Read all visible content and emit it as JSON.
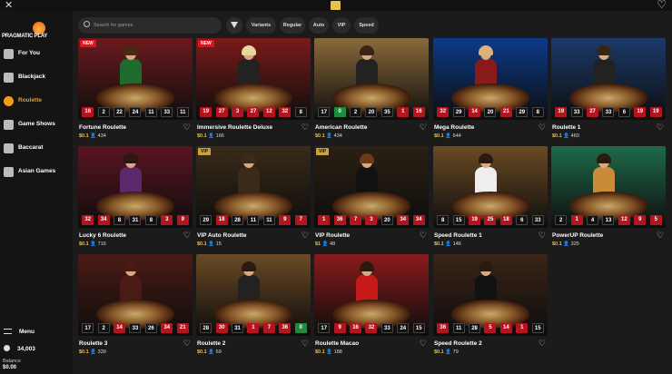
{
  "topbar": {
    "close_glyph": "✕",
    "heart_glyph": "♡"
  },
  "brand": {
    "name": "PRAGMATIC PLAY"
  },
  "sidebar": {
    "items": [
      {
        "label": "For You",
        "icon": "sparkle-icon",
        "active": false
      },
      {
        "label": "Blackjack",
        "icon": "cards-icon",
        "active": false
      },
      {
        "label": "Roulette",
        "icon": "roulette-icon",
        "active": true
      },
      {
        "label": "Game Shows",
        "icon": "gameshow-icon",
        "active": false
      },
      {
        "label": "Baccarat",
        "icon": "baccarat-icon",
        "active": false
      },
      {
        "label": "Asian Games",
        "icon": "asian-games-icon",
        "active": false
      }
    ],
    "menu_label": "Menu",
    "player_count": "34,003",
    "balance_label": "Balance",
    "balance_value": "$0.00"
  },
  "filters": {
    "search_placeholder": "Search for games",
    "chips": [
      "Variants",
      "Regular",
      "Auto",
      "VIP",
      "Speed"
    ]
  },
  "games": [
    {
      "title": "Fortune Roulette",
      "stake": "$0.1",
      "players": "434",
      "badge": "NEW",
      "numbers": [
        [
          "16",
          "r"
        ],
        [
          "2",
          "b"
        ],
        [
          "22",
          "b"
        ],
        [
          "24",
          "b"
        ],
        [
          "11",
          "b"
        ],
        [
          "33",
          "b"
        ],
        [
          "11",
          "b"
        ]
      ],
      "bg": "#6b1a1e",
      "hair": "#4a2a14",
      "body": "#1f6b2e"
    },
    {
      "title": "Immersive Roulette Deluxe",
      "stake": "$0.1",
      "players": "166",
      "badge": "NEW",
      "numbers": [
        [
          "19",
          "r"
        ],
        [
          "27",
          "r"
        ],
        [
          "3",
          "r"
        ],
        [
          "27",
          "r"
        ],
        [
          "12",
          "r"
        ],
        [
          "32",
          "r"
        ],
        [
          "8",
          "b"
        ]
      ],
      "bg": "#7a1a1a",
      "hair": "#e8d6a0",
      "body": "#222"
    },
    {
      "title": "American Roulette",
      "stake": "$0.1",
      "players": "434",
      "badge": "",
      "numbers": [
        [
          "17",
          "b"
        ],
        [
          "0",
          "g"
        ],
        [
          "2",
          "b"
        ],
        [
          "20",
          "b"
        ],
        [
          "35",
          "b"
        ],
        [
          "1",
          "r"
        ],
        [
          "16",
          "r"
        ]
      ],
      "bg": "#8a6a3a",
      "hair": "#3a2414",
      "body": "#222"
    },
    {
      "title": "Mega Roulette",
      "stake": "$0.1",
      "players": "644",
      "badge": "",
      "numbers": [
        [
          "32",
          "r"
        ],
        [
          "29",
          "b"
        ],
        [
          "14",
          "r"
        ],
        [
          "20",
          "b"
        ],
        [
          "21",
          "r"
        ],
        [
          "29",
          "b"
        ],
        [
          "8",
          "b"
        ]
      ],
      "bg": "#0c3a8a",
      "hair": "#d9b37a",
      "body": "#8a1a1a"
    },
    {
      "title": "Roulette 1",
      "stake": "$0.1",
      "players": "460",
      "badge": "",
      "numbers": [
        [
          "19",
          "r"
        ],
        [
          "33",
          "b"
        ],
        [
          "27",
          "r"
        ],
        [
          "33",
          "b"
        ],
        [
          "6",
          "b"
        ],
        [
          "19",
          "r"
        ],
        [
          "19",
          "r"
        ]
      ],
      "bg": "#1c3a6a",
      "hair": "#3a2414",
      "body": "#222"
    },
    {
      "title": "Lucky 6 Roulette",
      "stake": "$0.1",
      "players": "716",
      "badge": "",
      "numbers": [
        [
          "32",
          "r"
        ],
        [
          "34",
          "r"
        ],
        [
          "8",
          "b"
        ],
        [
          "31",
          "b"
        ],
        [
          "8",
          "b"
        ],
        [
          "3",
          "r"
        ],
        [
          "9",
          "r"
        ]
      ],
      "bg": "#5a1420",
      "hair": "#2a1a10",
      "body": "#5a2a6a"
    },
    {
      "title": "VIP Auto Roulette",
      "stake": "$0.1",
      "players": "15",
      "badge": "VIP",
      "numbers": [
        [
          "29",
          "b"
        ],
        [
          "18",
          "r"
        ],
        [
          "28",
          "b"
        ],
        [
          "11",
          "b"
        ],
        [
          "11",
          "b"
        ],
        [
          "9",
          "r"
        ],
        [
          "7",
          "r"
        ]
      ],
      "bg": "#3a2a1a",
      "hair": "#3a2a1a",
      "body": "#3a2a1a"
    },
    {
      "title": "VIP Roulette",
      "stake": "$1",
      "players": "48",
      "badge": "VIP",
      "numbers": [
        [
          "1",
          "r"
        ],
        [
          "36",
          "r"
        ],
        [
          "7",
          "r"
        ],
        [
          "3",
          "r"
        ],
        [
          "20",
          "b"
        ],
        [
          "34",
          "r"
        ],
        [
          "34",
          "r"
        ]
      ],
      "bg": "#2a2014",
      "hair": "#6a3a1a",
      "body": "#111"
    },
    {
      "title": "Speed Roulette 1",
      "stake": "$0.1",
      "players": "146",
      "badge": "",
      "numbers": [
        [
          "8",
          "b"
        ],
        [
          "15",
          "b"
        ],
        [
          "19",
          "r"
        ],
        [
          "25",
          "r"
        ],
        [
          "18",
          "r"
        ],
        [
          "6",
          "b"
        ],
        [
          "33",
          "b"
        ]
      ],
      "bg": "#6a4a24",
      "hair": "#2a1a10",
      "body": "#eee"
    },
    {
      "title": "PowerUP Roulette",
      "stake": "$0.1",
      "players": "325",
      "badge": "",
      "numbers": [
        [
          "2",
          "b"
        ],
        [
          "1",
          "r"
        ],
        [
          "4",
          "b"
        ],
        [
          "13",
          "b"
        ],
        [
          "12",
          "r"
        ],
        [
          "9",
          "r"
        ],
        [
          "5",
          "r"
        ]
      ],
      "bg": "#1e6a4a",
      "hair": "#2a1a10",
      "body": "#c98a3a"
    },
    {
      "title": "Roulette 3",
      "stake": "$0.1",
      "players": "339",
      "badge": "",
      "numbers": [
        [
          "17",
          "b"
        ],
        [
          "2",
          "b"
        ],
        [
          "14",
          "r"
        ],
        [
          "33",
          "b"
        ],
        [
          "26",
          "b"
        ],
        [
          "34",
          "r"
        ],
        [
          "21",
          "r"
        ]
      ],
      "bg": "#4a1a14",
      "hair": "#4a1a14",
      "body": "#4a1a14"
    },
    {
      "title": "Roulette 2",
      "stake": "$0.1",
      "players": "69",
      "badge": "",
      "numbers": [
        [
          "28",
          "b"
        ],
        [
          "30",
          "r"
        ],
        [
          "31",
          "b"
        ],
        [
          "1",
          "r"
        ],
        [
          "7",
          "r"
        ],
        [
          "36",
          "r"
        ],
        [
          "0",
          "g"
        ]
      ],
      "bg": "#6a4a24",
      "hair": "#2a1a10",
      "body": "#222"
    },
    {
      "title": "Roulette Macao",
      "stake": "$0.1",
      "players": "188",
      "badge": "",
      "numbers": [
        [
          "17",
          "b"
        ],
        [
          "9",
          "r"
        ],
        [
          "16",
          "r"
        ],
        [
          "32",
          "r"
        ],
        [
          "33",
          "b"
        ],
        [
          "24",
          "b"
        ],
        [
          "15",
          "b"
        ]
      ],
      "bg": "#8a1a1a",
      "hair": "#2a1a10",
      "body": "#c91a1a"
    },
    {
      "title": "Speed Roulette 2",
      "stake": "$0.1",
      "players": "79",
      "badge": "",
      "numbers": [
        [
          "36",
          "r"
        ],
        [
          "11",
          "b"
        ],
        [
          "28",
          "b"
        ],
        [
          "5",
          "r"
        ],
        [
          "14",
          "r"
        ],
        [
          "1",
          "r"
        ],
        [
          "15",
          "b"
        ]
      ],
      "bg": "#3a2418",
      "hair": "#2a1a10",
      "body": "#111"
    }
  ]
}
